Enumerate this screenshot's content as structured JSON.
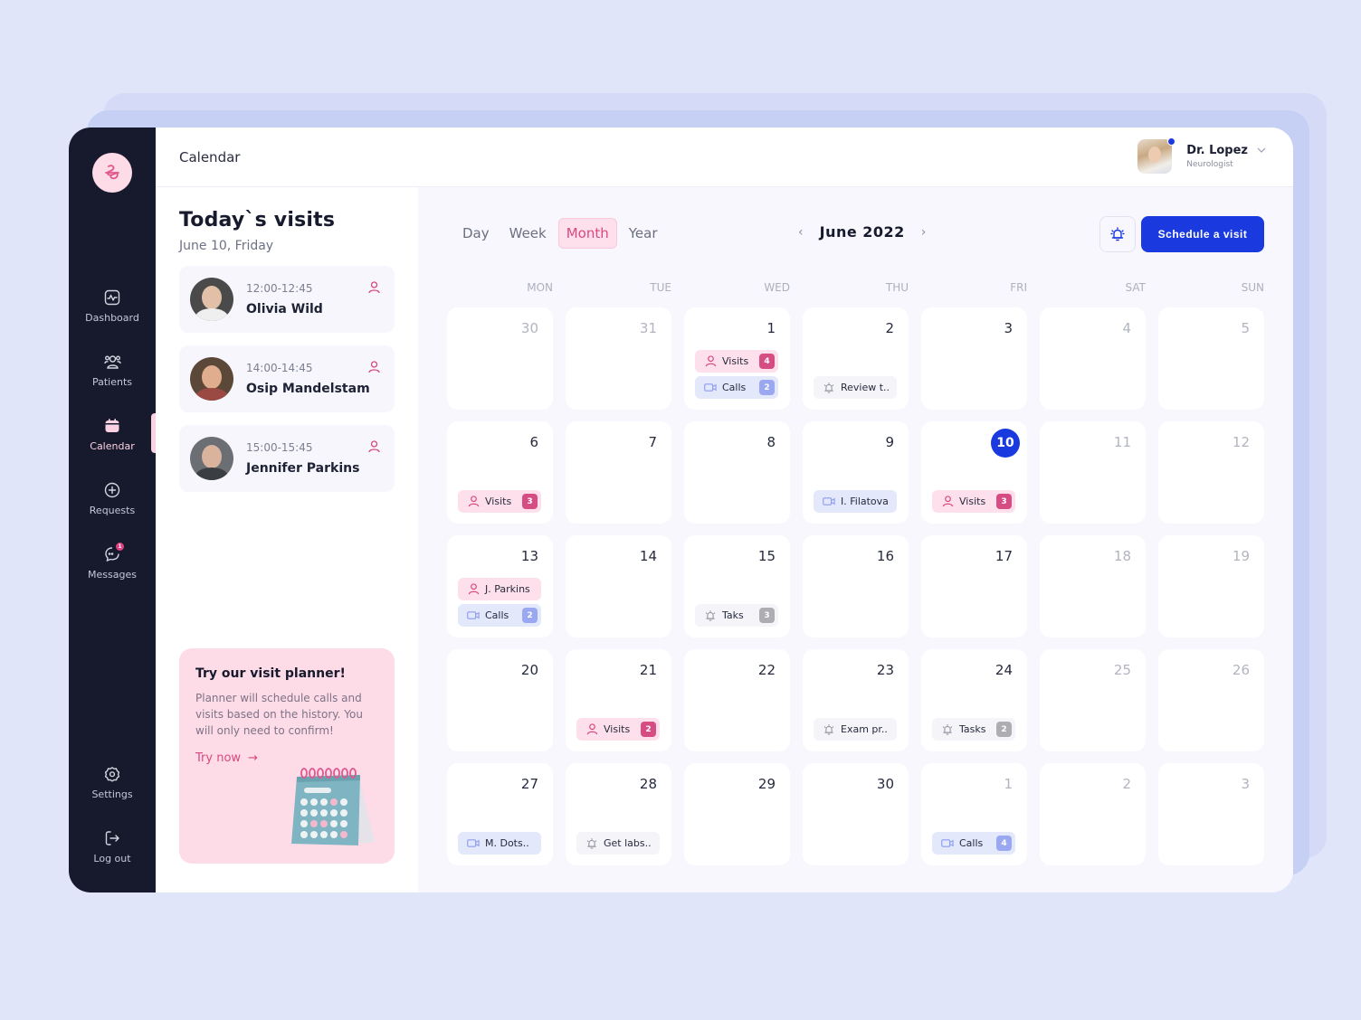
{
  "app": {
    "page_title": "Calendar",
    "brand_color": "#1a3ae0",
    "accent_pink": "#d9487e"
  },
  "sidebar": {
    "items": [
      {
        "label": "Dashboard",
        "icon": "chart-line-icon",
        "active": false
      },
      {
        "label": "Patients",
        "icon": "users-icon",
        "active": false
      },
      {
        "label": "Calendar",
        "icon": "calendar-icon",
        "active": true
      },
      {
        "label": "Requests",
        "icon": "plus-circle-icon",
        "active": false
      },
      {
        "label": "Messages",
        "icon": "chat-icon",
        "active": false,
        "badge": "1"
      }
    ],
    "bottom_items": [
      {
        "label": "Settings",
        "icon": "gear-icon"
      },
      {
        "label": "Log out",
        "icon": "logout-icon"
      }
    ]
  },
  "profile": {
    "name": "Dr. Lopez",
    "role": "Neurologist"
  },
  "today": {
    "title": "Today`s visits",
    "date": "June 10, Friday",
    "visits": [
      {
        "time": "12:00-12:45",
        "name": "Olivia Wild"
      },
      {
        "time": "14:00-14:45",
        "name": "Osip Mandelstam"
      },
      {
        "time": "15:00-15:45",
        "name": "Jennifer Parkins"
      }
    ]
  },
  "promo": {
    "title": "Try our visit planner!",
    "description": "Planner will schedule calls and visits based on the history.  You will only need to confirm!",
    "cta": "Try now",
    "cta_arrow": "→"
  },
  "calendar": {
    "views": [
      "Day",
      "Week",
      "Month",
      "Year"
    ],
    "active_view": "Month",
    "month_label": "June 2022",
    "prev": "‹",
    "next": "›",
    "schedule_button": "Schedule a visit",
    "weekdays": [
      "MON",
      "TUE",
      "WED",
      "THU",
      "FRI",
      "SAT",
      "SUN"
    ],
    "weeks": [
      [
        {
          "day": "30",
          "muted": true,
          "events": []
        },
        {
          "day": "31",
          "muted": true,
          "events": []
        },
        {
          "day": "1",
          "events": [
            {
              "type": "visit",
              "label": "Visits",
              "count": "4"
            },
            {
              "type": "call",
              "label": "Calls",
              "count": "2"
            }
          ]
        },
        {
          "day": "2",
          "events": [
            {
              "type": "task",
              "label": "Review t.."
            }
          ]
        },
        {
          "day": "3",
          "events": []
        },
        {
          "day": "4",
          "muted": true,
          "events": []
        },
        {
          "day": "5",
          "muted": true,
          "events": []
        }
      ],
      [
        {
          "day": "6",
          "events": [
            {
              "type": "visit",
              "label": "Visits",
              "count": "3"
            }
          ]
        },
        {
          "day": "7",
          "events": []
        },
        {
          "day": "8",
          "events": []
        },
        {
          "day": "9",
          "events": [
            {
              "type": "call",
              "label": "I. Filatova"
            }
          ]
        },
        {
          "day": "10",
          "today": true,
          "events": [
            {
              "type": "visit",
              "label": "Visits",
              "count": "3"
            }
          ]
        },
        {
          "day": "11",
          "muted": true,
          "events": []
        },
        {
          "day": "12",
          "muted": true,
          "events": []
        }
      ],
      [
        {
          "day": "13",
          "events": [
            {
              "type": "visit",
              "label": "J. Parkins"
            },
            {
              "type": "call",
              "label": "Calls",
              "count": "2"
            }
          ]
        },
        {
          "day": "14",
          "events": []
        },
        {
          "day": "15",
          "events": [
            {
              "type": "task",
              "label": "Taks",
              "count": "3"
            }
          ]
        },
        {
          "day": "16",
          "events": []
        },
        {
          "day": "17",
          "events": []
        },
        {
          "day": "18",
          "muted": true,
          "events": []
        },
        {
          "day": "19",
          "muted": true,
          "events": []
        }
      ],
      [
        {
          "day": "20",
          "events": []
        },
        {
          "day": "21",
          "events": [
            {
              "type": "visit",
              "label": "Visits",
              "count": "2"
            }
          ]
        },
        {
          "day": "22",
          "events": []
        },
        {
          "day": "23",
          "events": [
            {
              "type": "task",
              "label": "Exam pr.."
            }
          ]
        },
        {
          "day": "24",
          "events": [
            {
              "type": "task",
              "label": "Tasks",
              "count": "2"
            }
          ]
        },
        {
          "day": "25",
          "muted": true,
          "events": []
        },
        {
          "day": "26",
          "muted": true,
          "events": []
        }
      ],
      [
        {
          "day": "27",
          "events": [
            {
              "type": "call",
              "label": "M.  Dots.."
            }
          ]
        },
        {
          "day": "28",
          "events": [
            {
              "type": "task",
              "label": "Get labs.."
            }
          ]
        },
        {
          "day": "29",
          "events": []
        },
        {
          "day": "30",
          "events": []
        },
        {
          "day": "1",
          "muted": true,
          "events": [
            {
              "type": "call",
              "label": "Calls",
              "count": "4"
            }
          ]
        },
        {
          "day": "2",
          "muted": true,
          "events": []
        },
        {
          "day": "3",
          "muted": true,
          "events": []
        }
      ]
    ]
  }
}
